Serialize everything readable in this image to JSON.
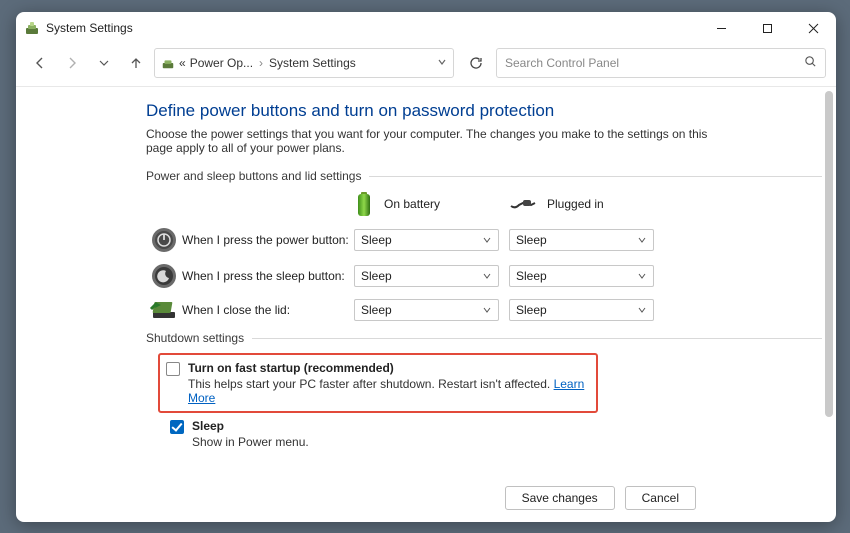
{
  "window": {
    "title": "System Settings"
  },
  "breadcrumb": {
    "prefix": "«",
    "crumb1": "Power Op...",
    "crumb2": "System Settings"
  },
  "search": {
    "placeholder": "Search Control Panel"
  },
  "page": {
    "title": "Define power buttons and turn on password protection",
    "desc": "Choose the power settings that you want for your computer. The changes you make to the settings on this page apply to all of your power plans."
  },
  "section": {
    "buttons_lid": "Power and sleep buttons and lid settings",
    "shutdown": "Shutdown settings"
  },
  "cols": {
    "battery": "On battery",
    "plugged": "Plugged in"
  },
  "rows": {
    "power_button": {
      "label": "When I press the power button:",
      "battery": "Sleep",
      "plugged": "Sleep"
    },
    "sleep_button": {
      "label": "When I press the sleep button:",
      "battery": "Sleep",
      "plugged": "Sleep"
    },
    "close_lid": {
      "label": "When I close the lid:",
      "battery": "Sleep",
      "plugged": "Sleep"
    }
  },
  "shutdown": {
    "fast_startup": {
      "label": "Turn on fast startup (recommended)",
      "desc": "This helps start your PC faster after shutdown. Restart isn't affected.",
      "learn": "Learn More",
      "checked": false
    },
    "sleep": {
      "label": "Sleep",
      "desc": "Show in Power menu.",
      "checked": true
    }
  },
  "buttons": {
    "save": "Save changes",
    "cancel": "Cancel"
  }
}
